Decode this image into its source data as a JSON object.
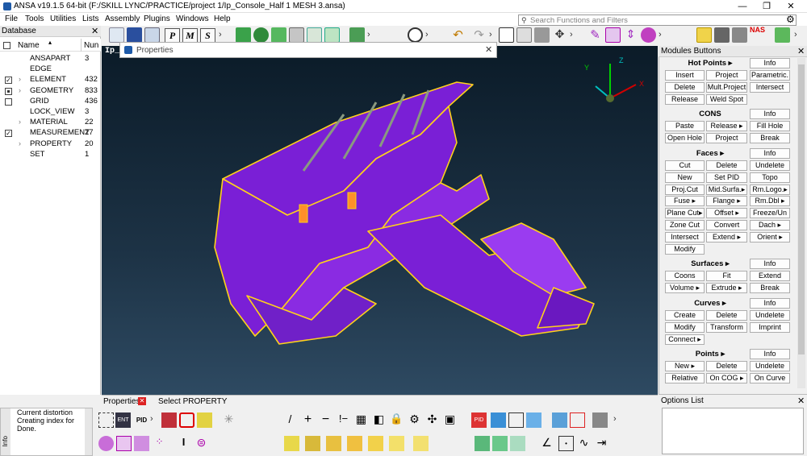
{
  "window": {
    "title": "ANSA v19.1.5 64-bit (F:/SKILL LYNC/PRACTICE/project 1/Ip_Console_Half 1 MESH 3.ansa)",
    "minimize": "—",
    "maximize": "❐",
    "close": "✕"
  },
  "menu": [
    "File",
    "Tools",
    "Utilities",
    "Lists",
    "Assembly",
    "Plugins",
    "Windows",
    "Help"
  ],
  "search": {
    "placeholder": "Search Functions and Filters"
  },
  "toolbar_letters": [
    "P",
    "M",
    "S"
  ],
  "database": {
    "title": "Database",
    "close": "✕",
    "col_name": "Name",
    "col_num": "Nun",
    "rows": [
      {
        "name": "ANSAPART",
        "num": "3",
        "check": "none",
        "expand": false
      },
      {
        "name": "EDGE",
        "num": "",
        "check": "none",
        "expand": false
      },
      {
        "name": "ELEMENT",
        "num": "432",
        "check": "checked",
        "expand": true
      },
      {
        "name": "GEOMETRY",
        "num": "833",
        "check": "partial",
        "expand": true
      },
      {
        "name": "GRID",
        "num": "436",
        "check": "empty",
        "expand": false
      },
      {
        "name": "LOCK_VIEW",
        "num": "3",
        "check": "none",
        "expand": false
      },
      {
        "name": "MATERIAL",
        "num": "22",
        "check": "none",
        "expand": true
      },
      {
        "name": "MEASUREMENT",
        "num": "27",
        "check": "checked",
        "expand": false
      },
      {
        "name": "PROPERTY",
        "num": "20",
        "check": "none",
        "expand": true
      },
      {
        "name": "SET",
        "num": "1",
        "check": "none",
        "expand": false
      }
    ]
  },
  "viewport": {
    "label": "Ip_"
  },
  "properties": {
    "title": "Properties",
    "close": "✕"
  },
  "axes": {
    "x": "X",
    "y": "Y",
    "z": "Z"
  },
  "modules": {
    "title": "Modules Buttons",
    "close": "✕",
    "sections": [
      {
        "title": "Hot Points ▸",
        "info": "Info",
        "buttons": [
          [
            "Insert",
            "Project",
            "Parametric."
          ],
          [
            "Delete",
            "Mult.Project",
            "Intersect"
          ],
          [
            "Release",
            "Weld Spot",
            ""
          ]
        ]
      },
      {
        "title": "CONS",
        "info": "Info",
        "buttons": [
          [
            "Paste",
            "Release ▸",
            "Fill Hole"
          ],
          [
            "Open Hole",
            "Project",
            "Break"
          ]
        ]
      },
      {
        "title": "Faces ▸",
        "info": "Info",
        "buttons": [
          [
            "Cut",
            "Delete",
            "Undelete"
          ],
          [
            "New",
            "Set PID",
            "Topo"
          ],
          [
            "Proj.Cut",
            "Mid.Surfa.▸",
            "Rm.Logo.▸"
          ],
          [
            "Fuse ▸",
            "Flange ▸",
            "Rm.Dbl ▸"
          ],
          [
            "Plane Cut▸",
            "Offset ▸",
            "Freeze/Un"
          ],
          [
            "Zone Cut",
            "Convert",
            "Dach ▸"
          ],
          [
            "Intersect",
            "Extend ▸",
            "Orient ▸"
          ],
          [
            "Modify",
            "",
            ""
          ]
        ]
      },
      {
        "title": "Surfaces ▸",
        "info": "Info",
        "buttons": [
          [
            "Coons",
            "Fit",
            "Extend"
          ],
          [
            "Volume ▸",
            "Extrude ▸",
            "Break"
          ]
        ]
      },
      {
        "title": "Curves ▸",
        "info": "Info",
        "buttons": [
          [
            "Create",
            "Delete",
            "Undelete"
          ],
          [
            "Modify",
            "Transform",
            "Imprint"
          ],
          [
            "Connect ▸",
            "",
            ""
          ]
        ]
      },
      {
        "title": "Points ▸",
        "info": "Info",
        "buttons": [
          [
            "New ▸",
            "Delete",
            "Undelete"
          ],
          [
            "Relative",
            "On COG ▸",
            "On Curve"
          ]
        ]
      }
    ]
  },
  "bottom": {
    "properties_tab": "Properties",
    "select_text": "Select PROPERTY"
  },
  "messages": {
    "lines": [
      "Current distortion",
      "Creating index for",
      "Done."
    ],
    "side_label": "Info"
  },
  "options": {
    "title": "Options List",
    "close": "✕"
  },
  "colors": {
    "viewport_top": "#0b1b28",
    "model_purple": "#7a1fd6",
    "model_edge": "#ffd21a",
    "accent_blue": "#1e5aa8"
  }
}
